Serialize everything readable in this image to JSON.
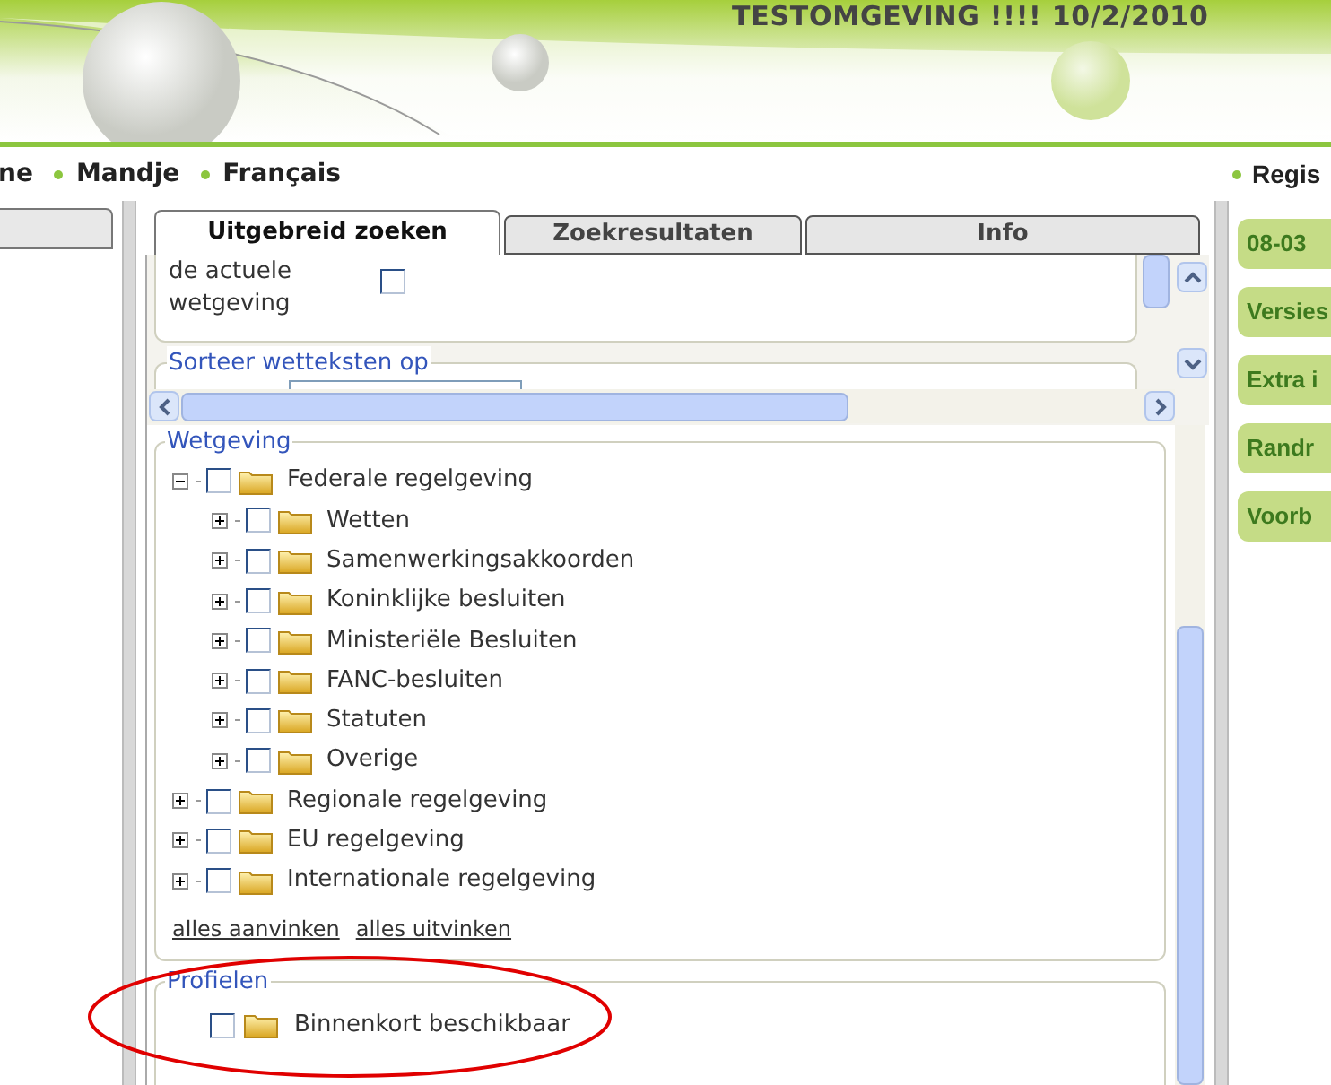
{
  "header": {
    "title": "TESTOMGEVING !!!! 10/2/2010"
  },
  "nav": {
    "items": [
      "ne",
      "Mandje",
      "Français"
    ],
    "right_item": "Regis"
  },
  "tabs": [
    {
      "label": "Uitgebreid zoeken",
      "selected": true
    },
    {
      "label": "Zoekresultaten",
      "selected": false
    },
    {
      "label": "Info",
      "selected": false
    }
  ],
  "current_option": {
    "label": "de actuele wetgeving",
    "checked": false
  },
  "sort_section": {
    "legend": "Sorteer wetteksten op"
  },
  "wetgeving": {
    "legend": "Wetgeving",
    "tree": [
      {
        "label": "Federale regelgeving",
        "checked": false,
        "expanded": true,
        "children": [
          {
            "label": "Wetten",
            "checked": false,
            "expanded": false
          },
          {
            "label": "Samenwerkingsakkoorden",
            "checked": false,
            "expanded": false
          },
          {
            "label": "Koninklijke besluiten",
            "checked": false,
            "expanded": false
          },
          {
            "label": "Ministeriële Besluiten",
            "checked": false,
            "expanded": false
          },
          {
            "label": "FANC-besluiten",
            "checked": false,
            "expanded": false
          },
          {
            "label": "Statuten",
            "checked": false,
            "expanded": false
          },
          {
            "label": "Overige",
            "checked": false,
            "expanded": false
          }
        ]
      },
      {
        "label": "Regionale regelgeving",
        "checked": false,
        "expanded": false
      },
      {
        "label": "EU regelgeving",
        "checked": false,
        "expanded": false
      },
      {
        "label": "Internationale regelgeving",
        "checked": false,
        "expanded": false
      }
    ],
    "links": [
      "alles aanvinken",
      "alles uitvinken"
    ]
  },
  "profielen": {
    "legend": "Profielen",
    "items": [
      {
        "label": "Binnenkort beschikbaar",
        "checked": false
      }
    ]
  },
  "side_tabs": [
    "08-03",
    "Versies",
    "Extra i",
    "Randr",
    "Voorb"
  ]
}
